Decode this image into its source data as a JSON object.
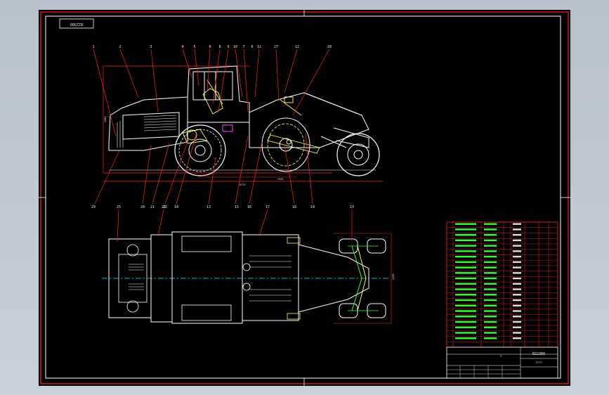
{
  "drawing_number": "BZ2300",
  "title_block": {
    "code": "BZ2300",
    "name": "?????",
    "scale_label": "??"
  },
  "side_view_labels": [
    "1",
    "2",
    "3",
    "4",
    "5",
    "6",
    "8",
    "9",
    "10",
    "7",
    "6",
    "11",
    "27",
    "12",
    "28"
  ],
  "bottom_labels": [
    "29",
    "20",
    "21",
    "22",
    "14",
    "13",
    "15",
    "16",
    "18",
    "19"
  ],
  "plan_view_labels": [
    "25",
    "22",
    "17",
    "23"
  ],
  "dimensions": {
    "overall_length": "8270",
    "height": "3400",
    "wheelbase": "2950",
    "rotor": "2300",
    "width": "2450"
  },
  "parts_rows": 23,
  "colors": {
    "sheet": "#000000",
    "frame": "#ffffff",
    "leader": "#ff2020",
    "parts": "#ffff66",
    "axis": "#00ffff",
    "table_text": "#33ff33"
  }
}
